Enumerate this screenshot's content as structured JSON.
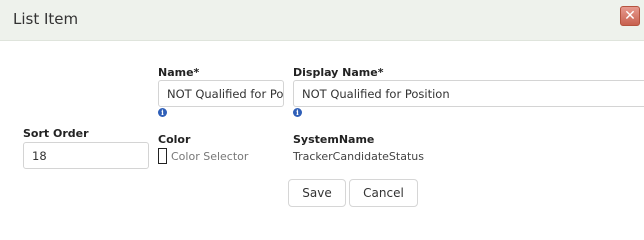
{
  "dialog": {
    "title": "List Item",
    "close_glyph": "✕"
  },
  "form": {
    "name_label": "Name*",
    "name_value": "NOT Qualified for Position",
    "display_name_label": "Display Name*",
    "display_name_value": "NOT Qualified for Position",
    "sort_order_label": "Sort Order",
    "sort_order_value": "18",
    "color_label": "Color",
    "color_selector_text": "Color Selector",
    "system_name_label": "SystemName",
    "system_name_value": "TrackerCandidateStatus",
    "info_glyph": "i"
  },
  "actions": {
    "save_label": "Save",
    "cancel_label": "Cancel"
  },
  "icons": {
    "close": "close-icon",
    "info": "info-icon"
  },
  "colors": {
    "header_bg": "#eef2ec",
    "close_button": "#c8614f",
    "info_blue": "#2f5fb8"
  }
}
